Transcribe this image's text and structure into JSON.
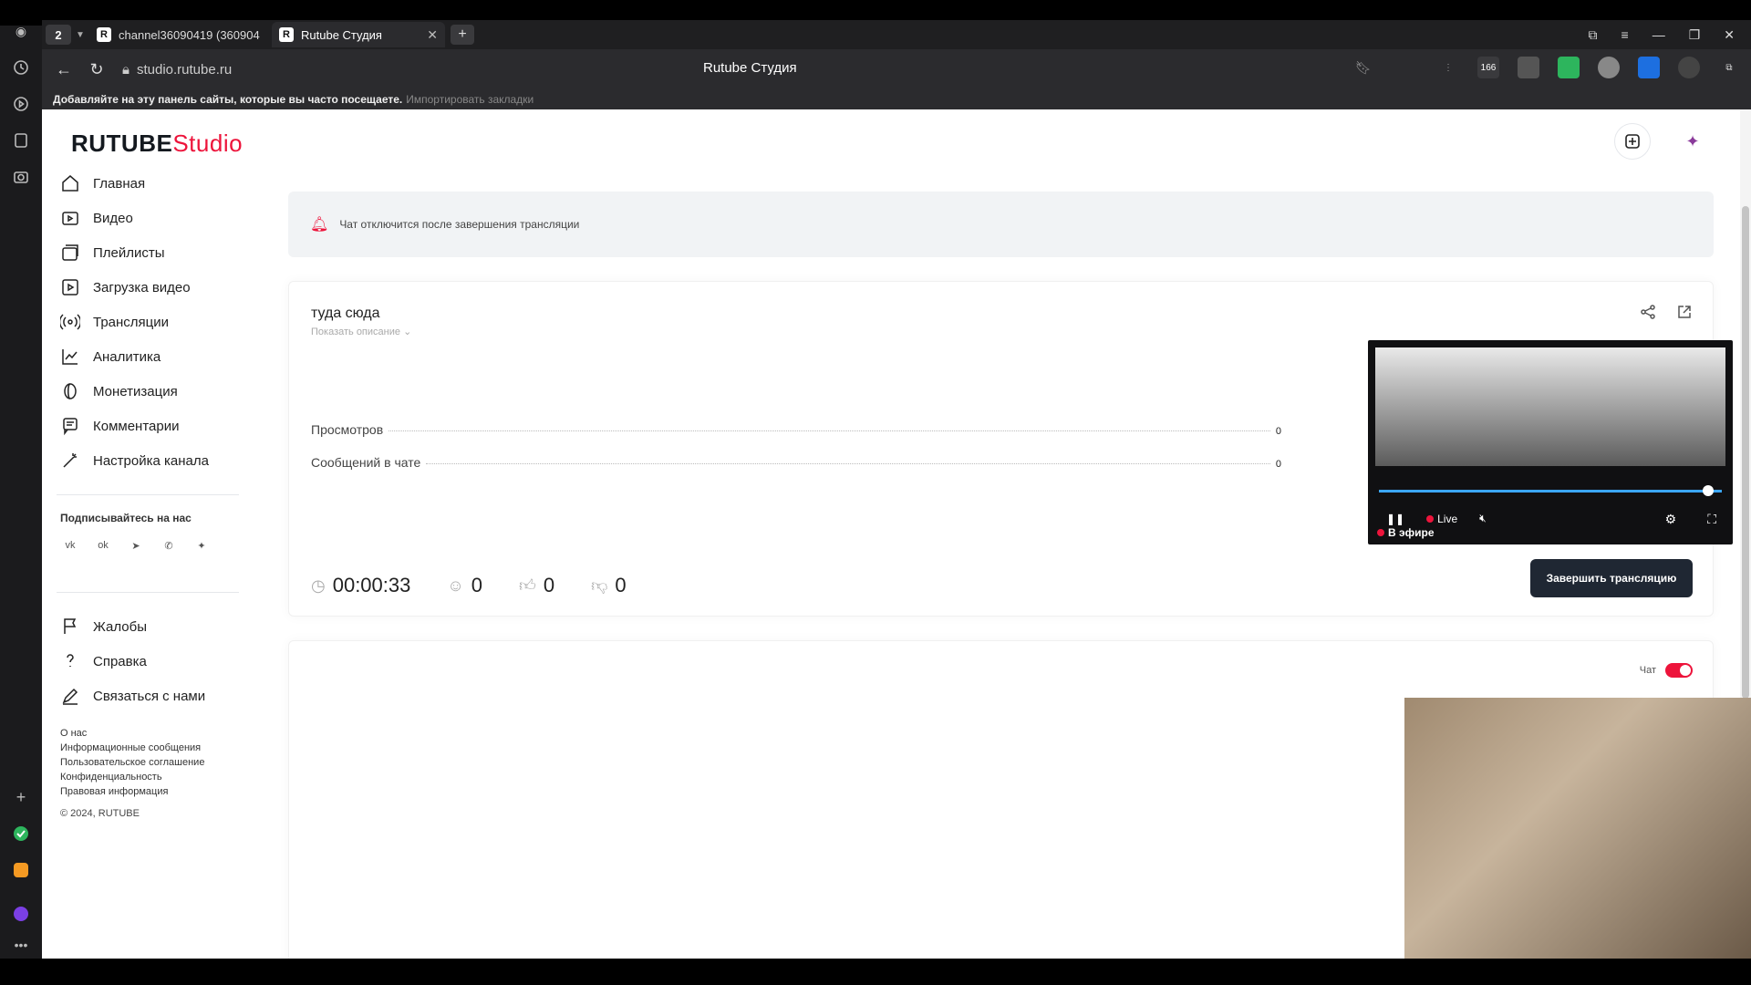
{
  "browser": {
    "tab_count": "2",
    "tabs": [
      {
        "title": "channel36090419 (360904",
        "favicon": "R"
      },
      {
        "title": "Rutube Студия",
        "favicon": "R"
      }
    ],
    "url": "studio.rutube.ru",
    "page_title": "Rutube Студия",
    "bookmarks_hint": "Добавляйте на эту панель сайты, которые вы часто посещаете.",
    "bookmarks_import": "Импортировать закладки",
    "extension_badge": "166"
  },
  "header": {
    "logo_main": "RUTUBE",
    "logo_accent": "Studio"
  },
  "sidebar": {
    "items": [
      {
        "label": "Главная",
        "icon": "home-icon"
      },
      {
        "label": "Видео",
        "icon": "video-icon"
      },
      {
        "label": "Плейлисты",
        "icon": "playlist-icon"
      },
      {
        "label": "Загрузка видео",
        "icon": "upload-icon"
      },
      {
        "label": "Трансляции",
        "icon": "broadcast-icon"
      },
      {
        "label": "Аналитика",
        "icon": "analytics-icon"
      },
      {
        "label": "Монетизация",
        "icon": "coin-icon"
      },
      {
        "label": "Комментарии",
        "icon": "comments-icon"
      },
      {
        "label": "Настройка канала",
        "icon": "magic-wand-icon"
      }
    ],
    "subscribe_label": "Подписывайтесь на нас",
    "support_items": [
      {
        "label": "Жалобы",
        "icon": "flag-icon"
      },
      {
        "label": "Справка",
        "icon": "help-icon"
      },
      {
        "label": "Связаться с нами",
        "icon": "pencil-icon"
      }
    ],
    "footer_links": [
      "О нас",
      "Информационные сообщения",
      "Пользовательское соглашение",
      "Конфиденциальность",
      "Правовая информация"
    ],
    "copyright": "© 2024, RUTUBE"
  },
  "banner": {
    "text": "Чат отключится после завершения трансляции"
  },
  "stream": {
    "title": "туда сюда",
    "show_description": "Показать описание",
    "views_label": "Просмотров",
    "views_value": "0",
    "chat_messages_label": "Сообщений в чате",
    "chat_messages_value": "0",
    "duration": "00:00:33",
    "viewers": "0",
    "likes": "0",
    "dislikes": "0",
    "end_button": "Завершить трансляцию",
    "player_live": "Live",
    "player_onair": "В эфире",
    "player_progress": 0.96
  },
  "chat": {
    "toggle_label": "Чат",
    "enabled": true
  },
  "colors": {
    "accent": "#ed143b",
    "dark_button": "#1f2733",
    "progress": "#3ba6ff"
  }
}
